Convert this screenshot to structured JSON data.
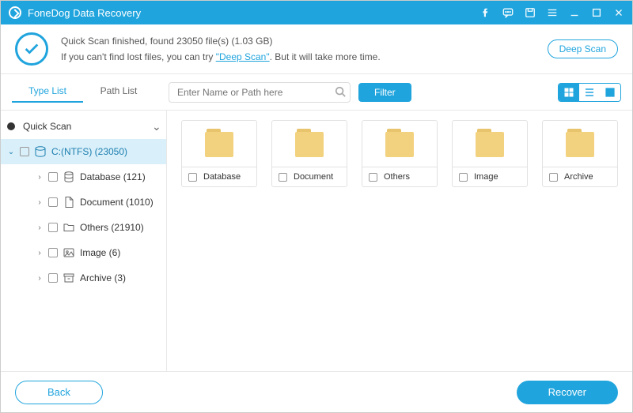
{
  "app": {
    "title": "FoneDog Data Recovery"
  },
  "status": {
    "line1": "Quick Scan finished, found 23050 file(s) (1.03 GB)",
    "line2a": "If you can't find lost files, you can try ",
    "deep_scan_link": "\"Deep Scan\"",
    "line2b": ". But it will take more time.",
    "deep_scan_button": "Deep Scan"
  },
  "toolbar": {
    "tab_type": "Type List",
    "tab_path": "Path List",
    "search_placeholder": "Enter Name or Path here",
    "filter": "Filter"
  },
  "tree": {
    "root": "Quick Scan",
    "drive": "C:(NTFS) (23050)",
    "children": [
      {
        "label": "Database (121)"
      },
      {
        "label": "Document (1010)"
      },
      {
        "label": "Others (21910)"
      },
      {
        "label": "Image (6)"
      },
      {
        "label": "Archive (3)"
      }
    ]
  },
  "folders": [
    {
      "label": "Database"
    },
    {
      "label": "Document"
    },
    {
      "label": "Others"
    },
    {
      "label": "Image"
    },
    {
      "label": "Archive"
    }
  ],
  "bottom": {
    "back": "Back",
    "recover": "Recover"
  },
  "colors": {
    "accent": "#20a4dd"
  }
}
